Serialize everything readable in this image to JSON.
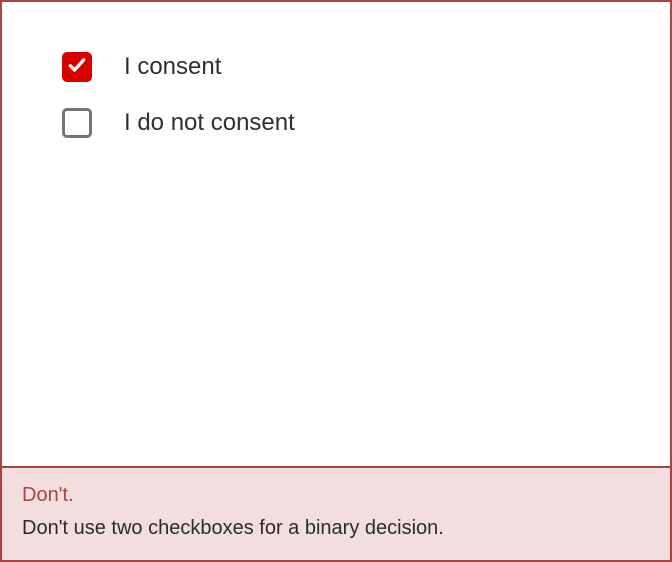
{
  "checkboxes": [
    {
      "label": "I consent",
      "checked": true
    },
    {
      "label": "I do not consent",
      "checked": false
    }
  ],
  "caption": {
    "heading": "Don't.",
    "text": "Don't use two checkboxes for a binary decision."
  }
}
